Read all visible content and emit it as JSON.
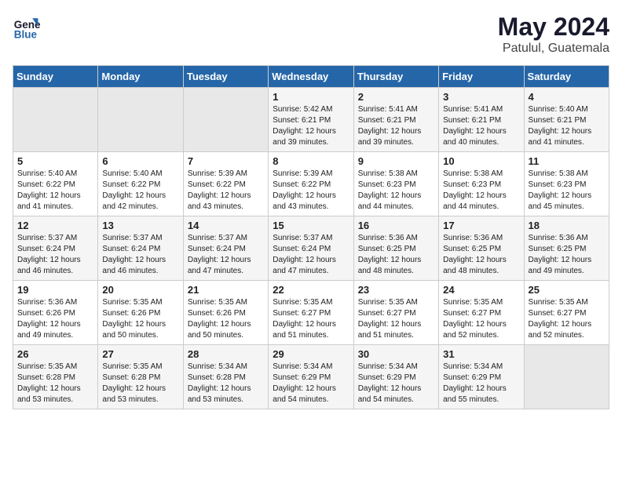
{
  "header": {
    "logo_line1": "General",
    "logo_line2": "Blue",
    "month_year": "May 2024",
    "location": "Patulul, Guatemala"
  },
  "weekdays": [
    "Sunday",
    "Monday",
    "Tuesday",
    "Wednesday",
    "Thursday",
    "Friday",
    "Saturday"
  ],
  "weeks": [
    [
      {
        "day": "",
        "info": ""
      },
      {
        "day": "",
        "info": ""
      },
      {
        "day": "",
        "info": ""
      },
      {
        "day": "1",
        "info": "Sunrise: 5:42 AM\nSunset: 6:21 PM\nDaylight: 12 hours\nand 39 minutes."
      },
      {
        "day": "2",
        "info": "Sunrise: 5:41 AM\nSunset: 6:21 PM\nDaylight: 12 hours\nand 39 minutes."
      },
      {
        "day": "3",
        "info": "Sunrise: 5:41 AM\nSunset: 6:21 PM\nDaylight: 12 hours\nand 40 minutes."
      },
      {
        "day": "4",
        "info": "Sunrise: 5:40 AM\nSunset: 6:21 PM\nDaylight: 12 hours\nand 41 minutes."
      }
    ],
    [
      {
        "day": "5",
        "info": "Sunrise: 5:40 AM\nSunset: 6:22 PM\nDaylight: 12 hours\nand 41 minutes."
      },
      {
        "day": "6",
        "info": "Sunrise: 5:40 AM\nSunset: 6:22 PM\nDaylight: 12 hours\nand 42 minutes."
      },
      {
        "day": "7",
        "info": "Sunrise: 5:39 AM\nSunset: 6:22 PM\nDaylight: 12 hours\nand 43 minutes."
      },
      {
        "day": "8",
        "info": "Sunrise: 5:39 AM\nSunset: 6:22 PM\nDaylight: 12 hours\nand 43 minutes."
      },
      {
        "day": "9",
        "info": "Sunrise: 5:38 AM\nSunset: 6:23 PM\nDaylight: 12 hours\nand 44 minutes."
      },
      {
        "day": "10",
        "info": "Sunrise: 5:38 AM\nSunset: 6:23 PM\nDaylight: 12 hours\nand 44 minutes."
      },
      {
        "day": "11",
        "info": "Sunrise: 5:38 AM\nSunset: 6:23 PM\nDaylight: 12 hours\nand 45 minutes."
      }
    ],
    [
      {
        "day": "12",
        "info": "Sunrise: 5:37 AM\nSunset: 6:24 PM\nDaylight: 12 hours\nand 46 minutes."
      },
      {
        "day": "13",
        "info": "Sunrise: 5:37 AM\nSunset: 6:24 PM\nDaylight: 12 hours\nand 46 minutes."
      },
      {
        "day": "14",
        "info": "Sunrise: 5:37 AM\nSunset: 6:24 PM\nDaylight: 12 hours\nand 47 minutes."
      },
      {
        "day": "15",
        "info": "Sunrise: 5:37 AM\nSunset: 6:24 PM\nDaylight: 12 hours\nand 47 minutes."
      },
      {
        "day": "16",
        "info": "Sunrise: 5:36 AM\nSunset: 6:25 PM\nDaylight: 12 hours\nand 48 minutes."
      },
      {
        "day": "17",
        "info": "Sunrise: 5:36 AM\nSunset: 6:25 PM\nDaylight: 12 hours\nand 48 minutes."
      },
      {
        "day": "18",
        "info": "Sunrise: 5:36 AM\nSunset: 6:25 PM\nDaylight: 12 hours\nand 49 minutes."
      }
    ],
    [
      {
        "day": "19",
        "info": "Sunrise: 5:36 AM\nSunset: 6:26 PM\nDaylight: 12 hours\nand 49 minutes."
      },
      {
        "day": "20",
        "info": "Sunrise: 5:35 AM\nSunset: 6:26 PM\nDaylight: 12 hours\nand 50 minutes."
      },
      {
        "day": "21",
        "info": "Sunrise: 5:35 AM\nSunset: 6:26 PM\nDaylight: 12 hours\nand 50 minutes."
      },
      {
        "day": "22",
        "info": "Sunrise: 5:35 AM\nSunset: 6:27 PM\nDaylight: 12 hours\nand 51 minutes."
      },
      {
        "day": "23",
        "info": "Sunrise: 5:35 AM\nSunset: 6:27 PM\nDaylight: 12 hours\nand 51 minutes."
      },
      {
        "day": "24",
        "info": "Sunrise: 5:35 AM\nSunset: 6:27 PM\nDaylight: 12 hours\nand 52 minutes."
      },
      {
        "day": "25",
        "info": "Sunrise: 5:35 AM\nSunset: 6:27 PM\nDaylight: 12 hours\nand 52 minutes."
      }
    ],
    [
      {
        "day": "26",
        "info": "Sunrise: 5:35 AM\nSunset: 6:28 PM\nDaylight: 12 hours\nand 53 minutes."
      },
      {
        "day": "27",
        "info": "Sunrise: 5:35 AM\nSunset: 6:28 PM\nDaylight: 12 hours\nand 53 minutes."
      },
      {
        "day": "28",
        "info": "Sunrise: 5:34 AM\nSunset: 6:28 PM\nDaylight: 12 hours\nand 53 minutes."
      },
      {
        "day": "29",
        "info": "Sunrise: 5:34 AM\nSunset: 6:29 PM\nDaylight: 12 hours\nand 54 minutes."
      },
      {
        "day": "30",
        "info": "Sunrise: 5:34 AM\nSunset: 6:29 PM\nDaylight: 12 hours\nand 54 minutes."
      },
      {
        "day": "31",
        "info": "Sunrise: 5:34 AM\nSunset: 6:29 PM\nDaylight: 12 hours\nand 55 minutes."
      },
      {
        "day": "",
        "info": ""
      }
    ]
  ]
}
